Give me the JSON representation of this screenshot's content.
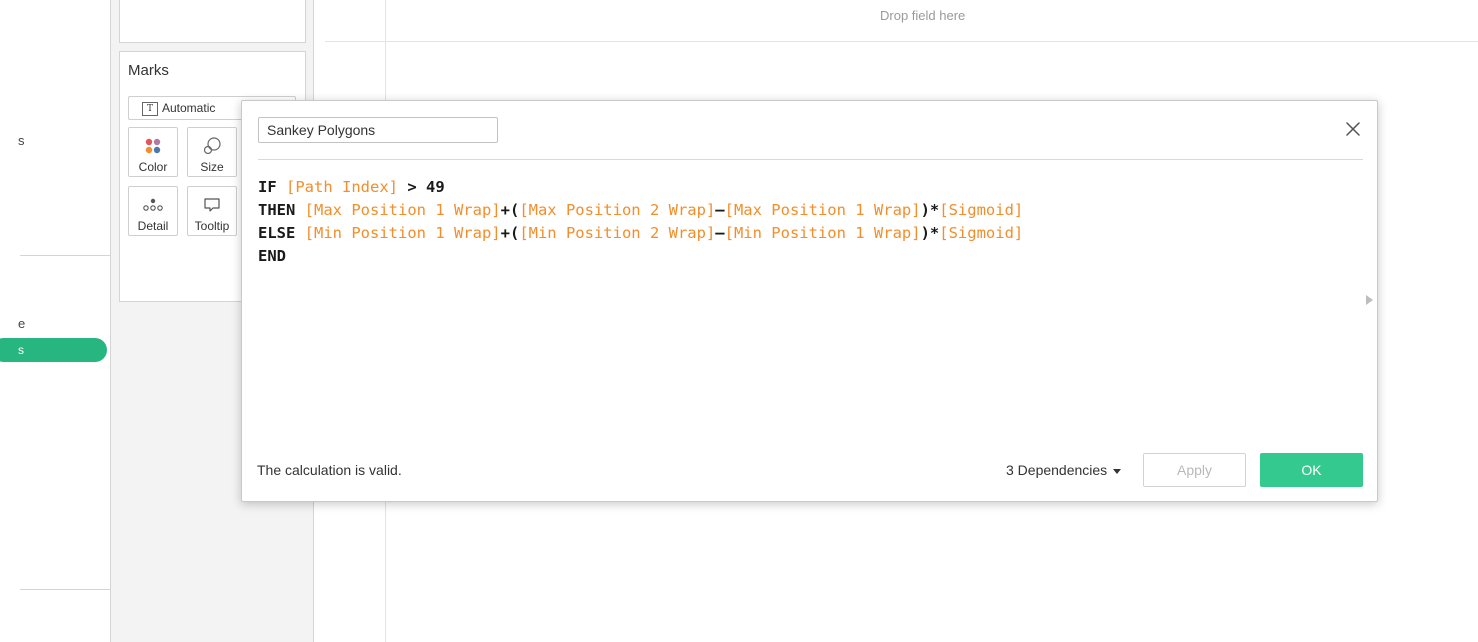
{
  "left_pane": {
    "fragment_1": "s",
    "fragment_2": "e",
    "pill_text": "s"
  },
  "marks": {
    "title": "Marks",
    "mark_type": "Automatic",
    "buttons": {
      "color": "Color",
      "size": "Size",
      "detail": "Detail",
      "tooltip": "Tooltip"
    }
  },
  "canvas": {
    "drop_hint": "Drop field here"
  },
  "dialog": {
    "calc_name": "Sankey Polygons",
    "formula": {
      "line1": {
        "kw": "IF",
        "field": "[Path Index]",
        "rest": " > 49"
      },
      "line2": {
        "kw": "THEN",
        "f1": "[Max Position 1 Wrap]",
        "o1": "+(",
        "f2": "[Max Position 2 Wrap]",
        "o2": "–",
        "f3": "[Max Position 1 Wrap]",
        "o3": ")*",
        "f4": "[Sigmoid]"
      },
      "line3": {
        "kw": "ELSE",
        "f1": "[Min Position 1 Wrap]",
        "o1": "+(",
        "f2": "[Min Position 2 Wrap]",
        "o2": "–",
        "f3": "[Min Position 1 Wrap]",
        "o3": ")*",
        "f4": "[Sigmoid]"
      },
      "line4": {
        "kw": "END"
      }
    },
    "status": "The calculation is valid.",
    "dependencies": "3 Dependencies",
    "apply_label": "Apply",
    "ok_label": "OK"
  },
  "colors": {
    "field": "#f28e2b",
    "ok_button": "#34c98e",
    "pill": "#27b580"
  },
  "icons": {
    "close": "close-icon",
    "color": "color-palette-icon",
    "size": "size-icon",
    "detail": "detail-dots-icon",
    "tooltip": "tooltip-bubble-icon",
    "mark_type": "text-mark-icon"
  }
}
